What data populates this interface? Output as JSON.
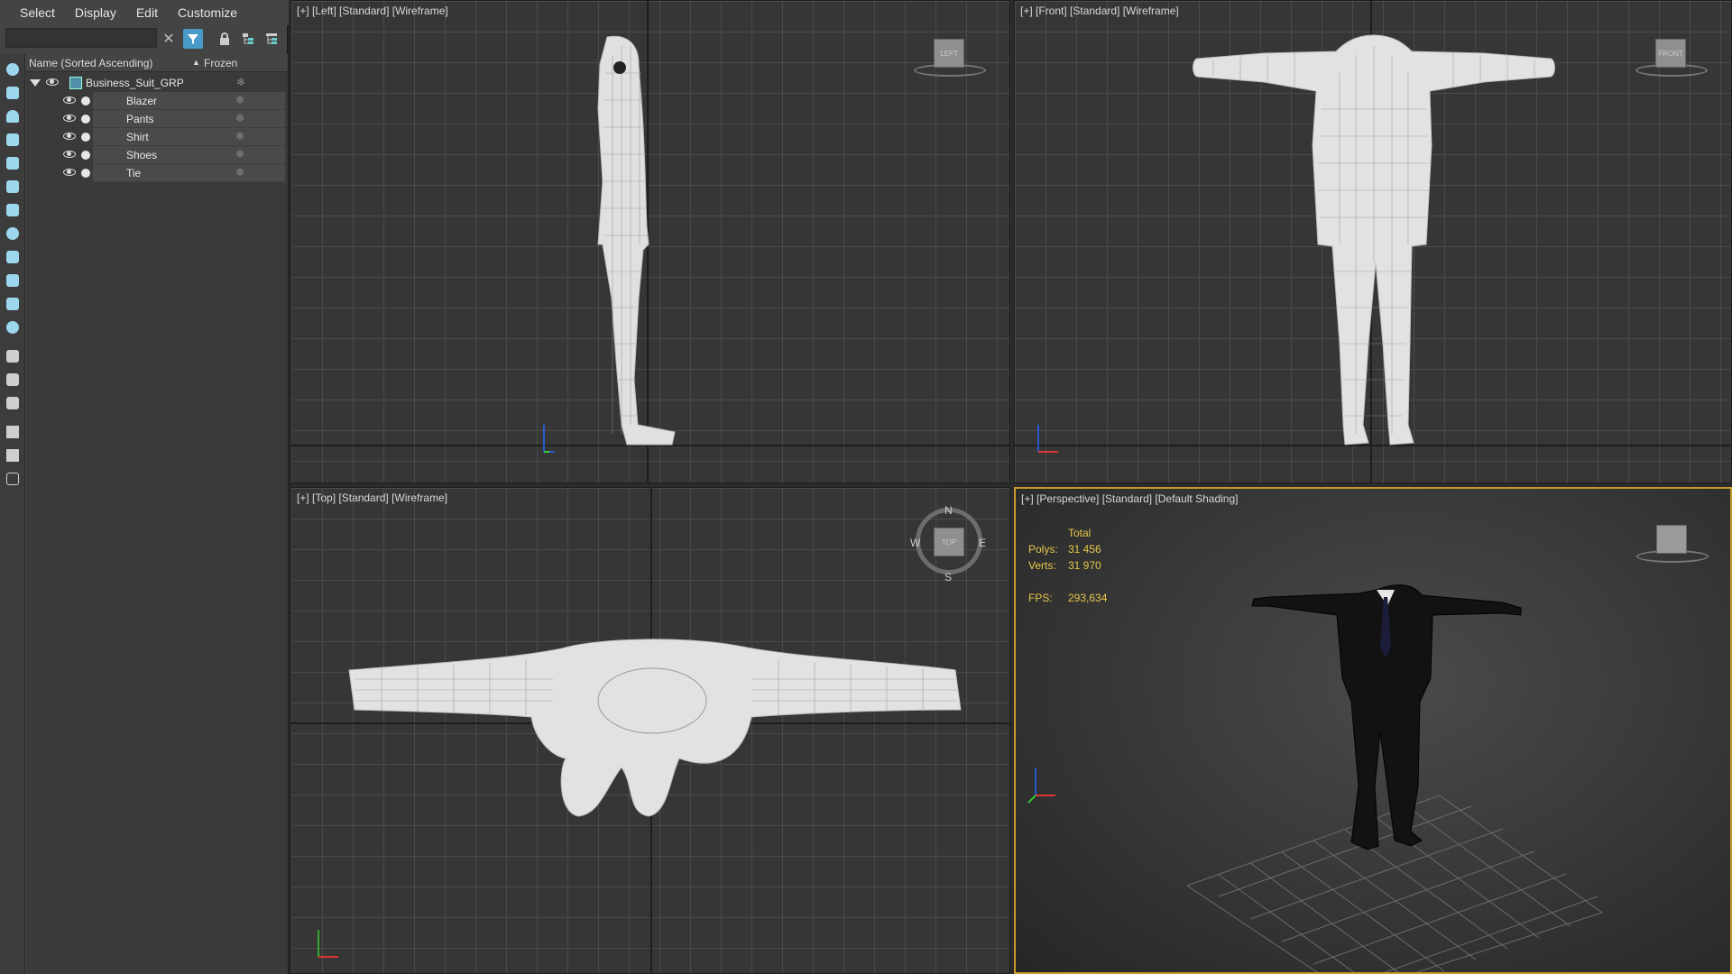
{
  "menubar": {
    "items": [
      "Select",
      "Display",
      "Edit",
      "Customize"
    ]
  },
  "toolbar": {
    "search_placeholder": ""
  },
  "tree": {
    "header": {
      "name_col": "Name (Sorted Ascending)",
      "frozen_col": "Frozen",
      "sort_arrow": "▲"
    },
    "group": {
      "label": "Business_Suit_GRP"
    },
    "children": [
      {
        "label": "Blazer"
      },
      {
        "label": "Pants"
      },
      {
        "label": "Shirt"
      },
      {
        "label": "Shoes"
      },
      {
        "label": "Tie"
      }
    ]
  },
  "viewports": {
    "left": {
      "label": "[+] [Left] [Standard] [Wireframe]",
      "cube": "LEFT"
    },
    "front": {
      "label": "[+] [Front] [Standard] [Wireframe]",
      "cube": "FRONT"
    },
    "top": {
      "label": "[+] [Top] [Standard] [Wireframe]",
      "cube": "TOP",
      "compass": {
        "n": "N",
        "s": "S",
        "e": "E",
        "w": "W"
      }
    },
    "perspective": {
      "label": "[+] [Perspective] [Standard] [Default Shading]",
      "stats": {
        "total_label": "Total",
        "polys_label": "Polys:",
        "polys_value": "31 456",
        "verts_label": "Verts:",
        "verts_value": "31 970",
        "fps_label": "FPS:",
        "fps_value": "293,634"
      }
    }
  },
  "colors": {
    "accent": "#4a9ac8",
    "active_border": "#c79a2a",
    "stats": "#e6c84a",
    "wireframe": "#e8e8e8"
  }
}
